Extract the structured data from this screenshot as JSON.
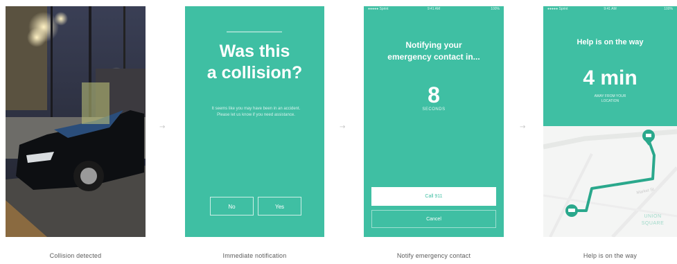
{
  "colors": {
    "teal": "#3fbfa3",
    "white": "#ffffff",
    "caption": "#5a5a5a"
  },
  "steps": [
    {
      "caption": "Collision detected"
    },
    {
      "caption": "Immediate notification"
    },
    {
      "caption": "Notify emergency contact"
    },
    {
      "caption": "Help is on the way"
    }
  ],
  "arrows": [
    "→",
    "→",
    "→"
  ],
  "collision_screen": {
    "title_line1": "Was this",
    "title_line2": "a collision?",
    "body": "It seems like you may have been in an accident. Please let us know if you need assistance.",
    "btn_left": "No",
    "btn_right": "Yes"
  },
  "notify_screen": {
    "status": {
      "left": "●●●●● Sprint",
      "center": "9:41 AM",
      "right": "100%"
    },
    "title_line1": "Notifying your",
    "title_line2": "emergency contact in...",
    "countdown": "8",
    "countdown_unit": "SECONDS",
    "call_label": "Call 911",
    "cancel_label": "Cancel"
  },
  "help_screen": {
    "status": {
      "left": "●●●●● Sprint",
      "center": "9:41 AM",
      "right": "100%"
    },
    "title": "Help is on the way",
    "eta": "4 min",
    "eta_sub_line1": "AWAY FROM YOUR",
    "eta_sub_line2": "LOCATION",
    "map_label_line1": "UNION",
    "map_label_line2": "SQUARE",
    "street_label": "Market St",
    "icons": {
      "car": "car-icon",
      "pin": "location-pin-icon"
    }
  }
}
